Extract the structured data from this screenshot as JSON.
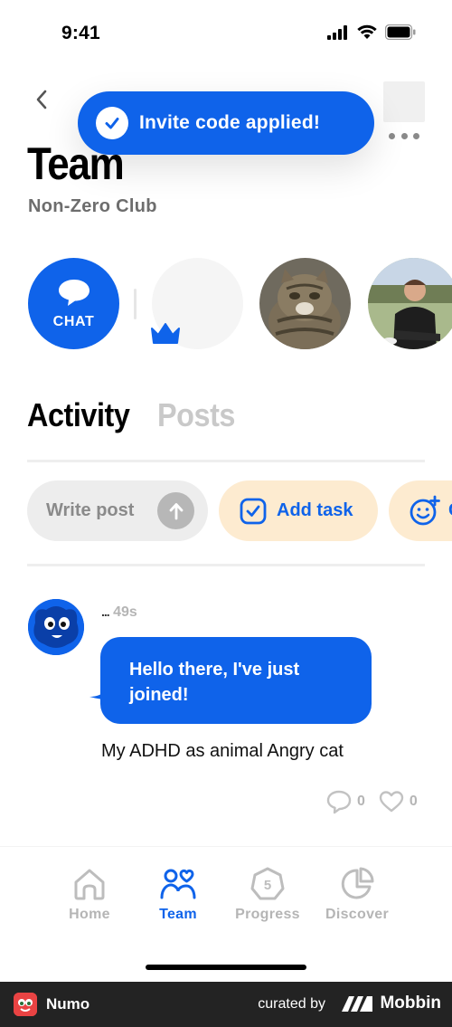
{
  "status_bar": {
    "time": "9:41"
  },
  "header": {
    "title": "Team",
    "subtitle": "Non-Zero Club"
  },
  "toast": {
    "message": "Invite code applied!"
  },
  "members_row": {
    "chat_label": "CHAT"
  },
  "tabs": [
    {
      "label": "Activity",
      "active": true
    },
    {
      "label": "Posts",
      "active": false
    }
  ],
  "actions": {
    "write_post_placeholder": "Write post",
    "add_task_label": "Add task"
  },
  "post": {
    "author_dots": "...",
    "time_ago": "49s",
    "message": "Hello there, I've just joined!",
    "body": "My ADHD as animal Angry cat",
    "comments_count": "0",
    "likes_count": "0"
  },
  "tabbar": {
    "items": [
      {
        "label": "Home",
        "icon": "home-icon",
        "active": false
      },
      {
        "label": "Team",
        "icon": "team-icon",
        "active": true
      },
      {
        "label": "Progress",
        "icon": "progress-icon",
        "active": false
      },
      {
        "label": "Discover",
        "icon": "discover-icon",
        "active": false
      }
    ]
  },
  "footer": {
    "app_name": "Numo",
    "curated_by": "curated by",
    "brand": "Mobbin"
  },
  "colors": {
    "accent": "#0f63ea",
    "chip_bg": "#fdebd0",
    "muted": "#b5b5b5"
  }
}
